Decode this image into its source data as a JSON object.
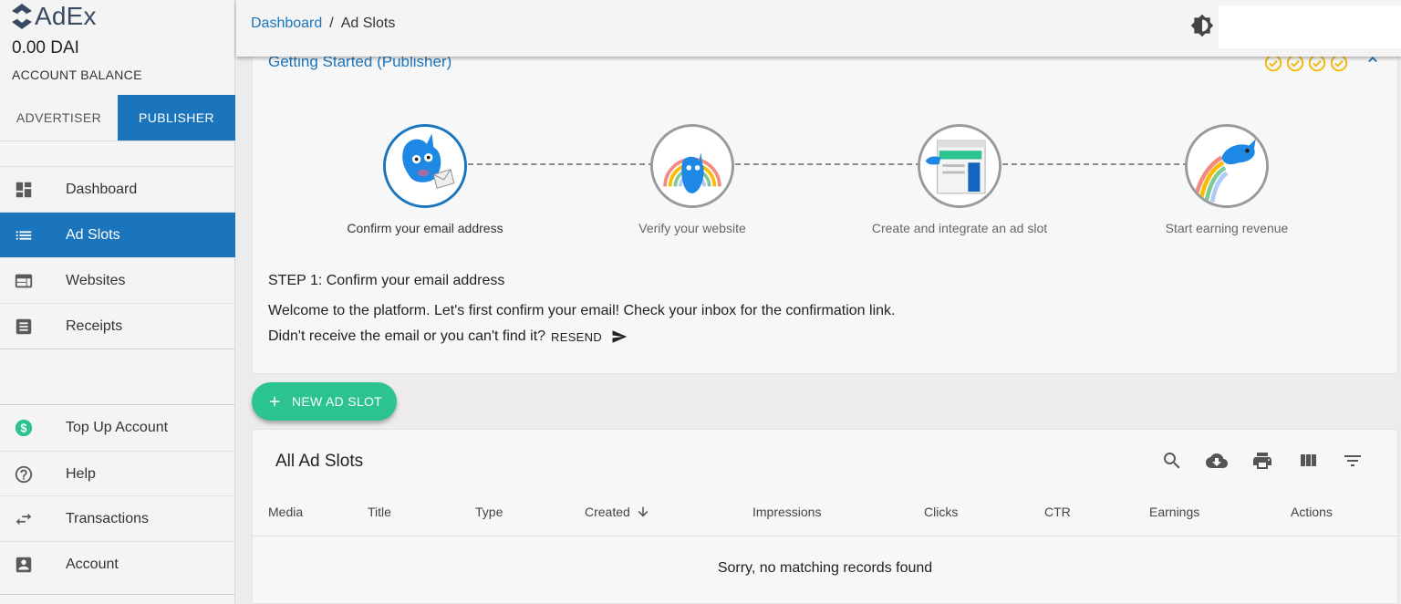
{
  "app": {
    "name": "AdEx"
  },
  "account": {
    "balance": "0.00 DAI",
    "balance_label": "ACCOUNT BALANCE"
  },
  "roles": {
    "advertiser": "ADVERTISER",
    "publisher": "PUBLISHER",
    "active": "publisher"
  },
  "sidebar": {
    "items": [
      {
        "label": "Dashboard",
        "icon": "dashboard-icon"
      },
      {
        "label": "Ad Slots",
        "icon": "list-icon"
      },
      {
        "label": "Websites",
        "icon": "web-icon"
      },
      {
        "label": "Receipts",
        "icon": "receipt-icon"
      }
    ],
    "bottom": [
      {
        "label": "Top Up Account",
        "icon": "dollar-icon"
      },
      {
        "label": "Help",
        "icon": "help-icon"
      },
      {
        "label": "Transactions",
        "icon": "swap-icon"
      },
      {
        "label": "Account",
        "icon": "account-box-icon"
      }
    ]
  },
  "breadcrumb": {
    "parent": "Dashboard",
    "separator": "/",
    "current": "Ad Slots"
  },
  "getting_started": {
    "title": "Getting Started (Publisher)",
    "steps": [
      {
        "label": "Confirm your email address"
      },
      {
        "label": "Verify your website"
      },
      {
        "label": "Create and integrate an ad slot"
      },
      {
        "label": "Start earning revenue"
      }
    ],
    "step_title": "STEP 1: Confirm your email address",
    "welcome": "Welcome to the platform. Let's first confirm your email! Check your inbox for the confirmation link.",
    "resend_prompt": "Didn't receive the email or you can't find it?",
    "resend_label": "RESEND"
  },
  "new_slot_button": "NEW AD SLOT",
  "table": {
    "title": "All Ad Slots",
    "columns": [
      "Media",
      "Title",
      "Type",
      "Created",
      "Impressions",
      "Clicks",
      "CTR",
      "Earnings",
      "Actions"
    ],
    "empty_message": "Sorry, no matching records found"
  },
  "colors": {
    "primary": "#1b75bc",
    "accent": "#2bc38e",
    "check": "#f2b705"
  }
}
